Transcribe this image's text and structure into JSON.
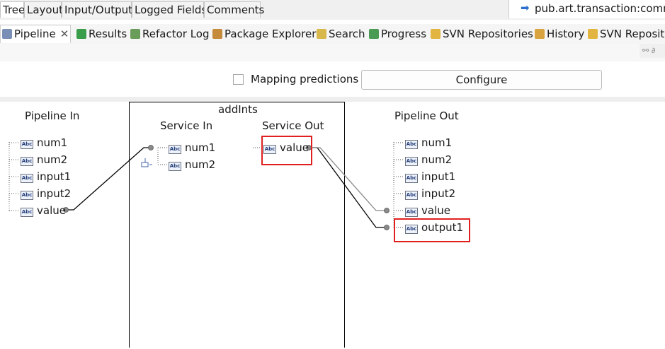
{
  "top_tabs": [
    "Tree",
    "Layout",
    "Input/Output",
    "Logged Fields",
    "Comments"
  ],
  "service_path": "pub.art.transaction:commitT",
  "view_tabs": [
    {
      "label": "Pipeline",
      "icon": "pipeline-icon"
    },
    {
      "label": "Results",
      "icon": "results-icon"
    },
    {
      "label": "Refactor Log",
      "icon": "refactor-log-icon"
    },
    {
      "label": "Package Explorer",
      "icon": "package-explorer-icon"
    },
    {
      "label": "Search",
      "icon": "search-icon"
    },
    {
      "label": "Progress",
      "icon": "progress-icon"
    },
    {
      "label": "SVN Repositories",
      "icon": "svn-repositories-icon"
    },
    {
      "label": "History",
      "icon": "history-icon"
    },
    {
      "label": "SVN Reposito",
      "icon": "svn-repositories-icon"
    }
  ],
  "toolbar": {
    "mapping_predictions_label": "Mapping predictions",
    "mapping_predictions_checked": false,
    "configure_label": "Configure"
  },
  "pipeline_in": {
    "title": "Pipeline In",
    "fields": [
      "num1",
      "num2",
      "input1",
      "input2",
      "value"
    ]
  },
  "service": {
    "title": "addInts",
    "service_in_title": "Service In",
    "service_in_fields": [
      "num1",
      "num2"
    ],
    "service_out_title": "Service Out",
    "service_out_fields": [
      "value"
    ]
  },
  "pipeline_out": {
    "title": "Pipeline Out",
    "fields": [
      "num1",
      "num2",
      "input1",
      "input2",
      "value",
      "output1"
    ]
  },
  "abc_icon_text": "Abc",
  "colors": {
    "highlight": "#e02020",
    "link_line": "#000000"
  }
}
